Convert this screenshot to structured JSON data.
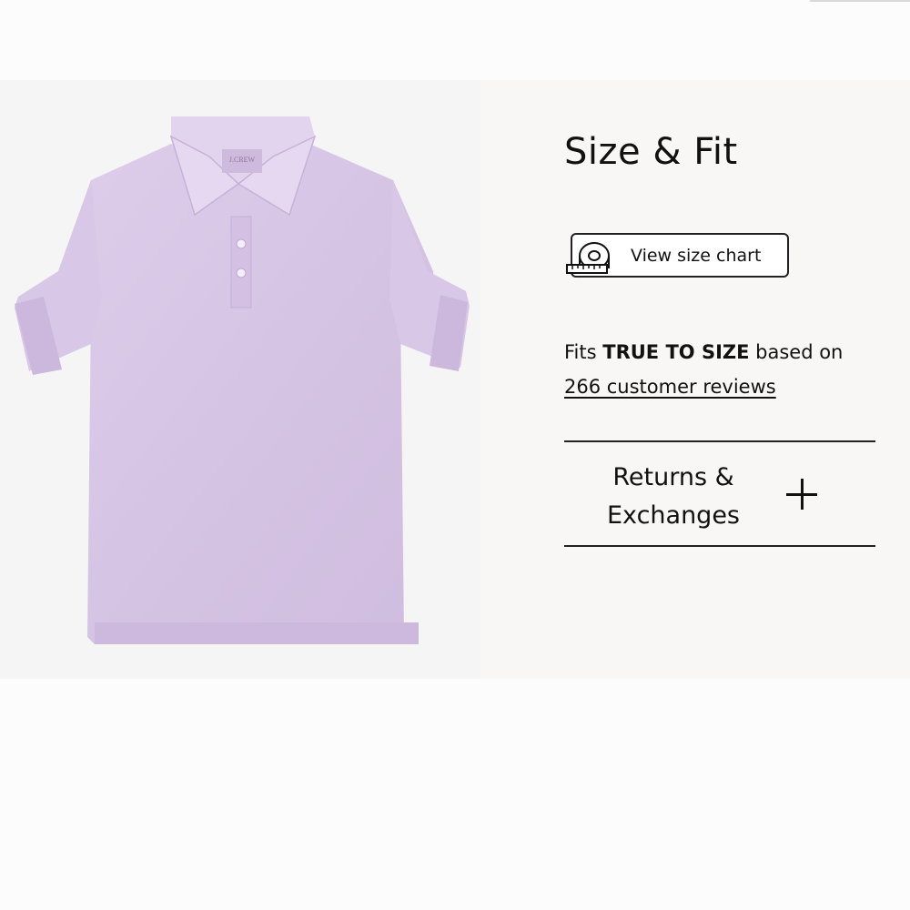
{
  "product_image": {
    "logo_text": "J.CREW",
    "shirt_color": "#d9c8e6"
  },
  "size_fit": {
    "title": "Size & Fit",
    "size_chart_button": "View size chart",
    "fit_prefix": "Fits ",
    "fit_emphasis": "TRUE TO SIZE",
    "fit_middle": " based on ",
    "reviews_link": "266 customer reviews"
  },
  "returns": {
    "label": "Returns & Exchanges",
    "toggle_icon": "plus-icon"
  }
}
